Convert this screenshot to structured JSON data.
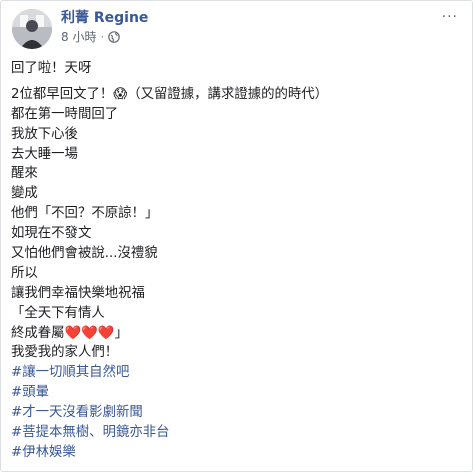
{
  "post": {
    "author": "利菁 Regine",
    "time": "8 小時",
    "separator": "·",
    "visibility_icon": "globe-icon",
    "more_label": "···",
    "paragraphs": [
      [
        "回了啦！天呀"
      ],
      [
        "2位都早回文了！😱（又留證據，講求證據的的時代）",
        "都在第一時間回了",
        "我放下心後",
        "去大睡一場",
        "醒來",
        "變成",
        "他們「不回？不原諒！」",
        "如現在不發文",
        "又怕他們會被說...沒禮貌",
        "所以",
        "讓我們幸福快樂地祝福",
        "「全天下有情人",
        "終成眷屬❤️❤️❤️」",
        "我愛我的家人們！"
      ]
    ],
    "hashtags": [
      "#讓一切順其自然吧",
      "#頭暈",
      "#才一天沒看影劇新聞",
      "#菩提本無樹、明鏡亦非台",
      "#伊林娛樂"
    ]
  },
  "colors": {
    "link": "#385898",
    "text": "#1c1e21",
    "meta": "#606770",
    "heart": "#e0245e"
  }
}
